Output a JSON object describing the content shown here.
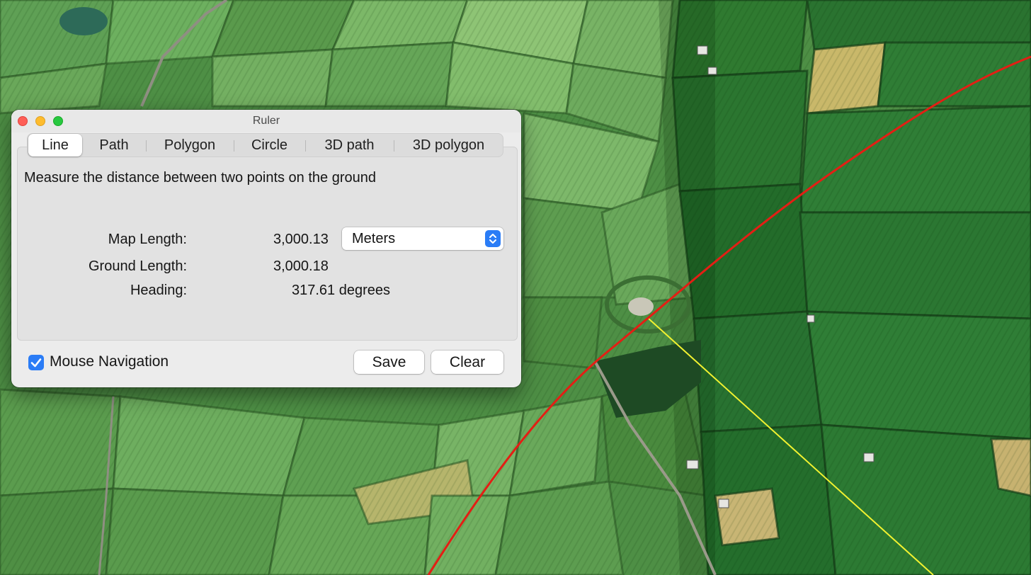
{
  "window": {
    "title": "Ruler"
  },
  "tabs": [
    {
      "label": "Line",
      "active": true
    },
    {
      "label": "Path",
      "active": false
    },
    {
      "label": "Polygon",
      "active": false
    },
    {
      "label": "Circle",
      "active": false
    },
    {
      "label": "3D path",
      "active": false
    },
    {
      "label": "3D polygon",
      "active": false
    }
  ],
  "description": "Measure the distance between two points on the ground",
  "measurements": {
    "map_length_label": "Map Length:",
    "map_length_value": "3,000.13",
    "ground_length_label": "Ground Length:",
    "ground_length_value": "3,000.18",
    "heading_label": "Heading:",
    "heading_value": "317.61 degrees"
  },
  "units": {
    "selected": "Meters"
  },
  "footer": {
    "mouse_navigation_label": "Mouse Navigation",
    "mouse_navigation_checked": true,
    "save_label": "Save",
    "clear_label": "Clear"
  },
  "colors": {
    "accent": "#2a7cf6",
    "measure_line": "#e41e14",
    "heading_line": "#f2f230"
  }
}
